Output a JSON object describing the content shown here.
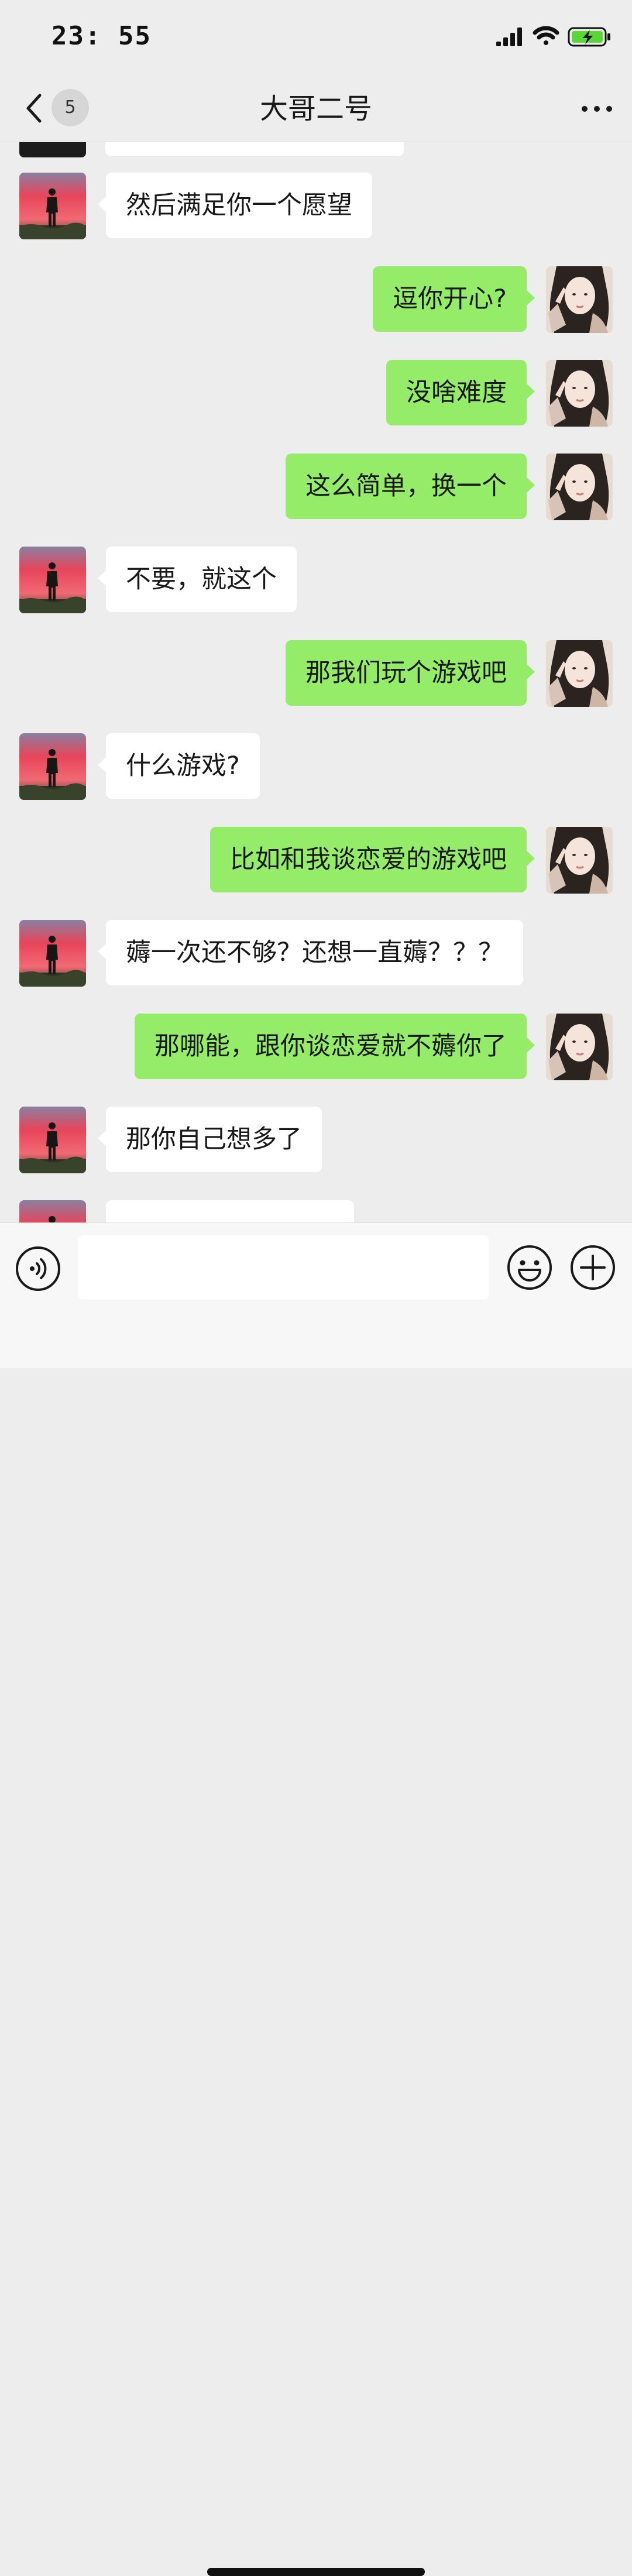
{
  "status_bar": {
    "time": "23: 55",
    "icons": [
      "signal-icon",
      "wifi-icon",
      "battery-charging-icon"
    ]
  },
  "nav": {
    "back_icon": "chevron-left-icon",
    "unread_count": "5",
    "title": "大哥二号",
    "more_icon": "more-dots-icon"
  },
  "messages": [
    {
      "side": "in",
      "text": "然后满足你一个愿望"
    },
    {
      "side": "out",
      "text": "逗你开心?"
    },
    {
      "side": "out",
      "text": "没啥难度"
    },
    {
      "side": "out",
      "text": "这么简单，换一个"
    },
    {
      "side": "in",
      "text": "不要，就这个"
    },
    {
      "side": "out",
      "text": "那我们玩个游戏吧"
    },
    {
      "side": "in",
      "text": "什么游戏?"
    },
    {
      "side": "out",
      "text": "比如和我谈恋爱的游戏吧"
    },
    {
      "side": "in",
      "text": "薅一次还不够？还想一直薅？？？"
    },
    {
      "side": "out",
      "text": "那哪能，跟你谈恋爱就不薅你了"
    },
    {
      "side": "in",
      "text": "那你自己想多了"
    }
  ],
  "input_bar": {
    "voice_icon": "voice-icon",
    "input_value": "",
    "emoji_icon": "emoji-icon",
    "plus_icon": "plus-icon"
  },
  "colors": {
    "background": "#ededed",
    "outgoing_bubble": "#95ec69",
    "incoming_bubble": "#ffffff",
    "battery_fill": "#5ad637"
  }
}
